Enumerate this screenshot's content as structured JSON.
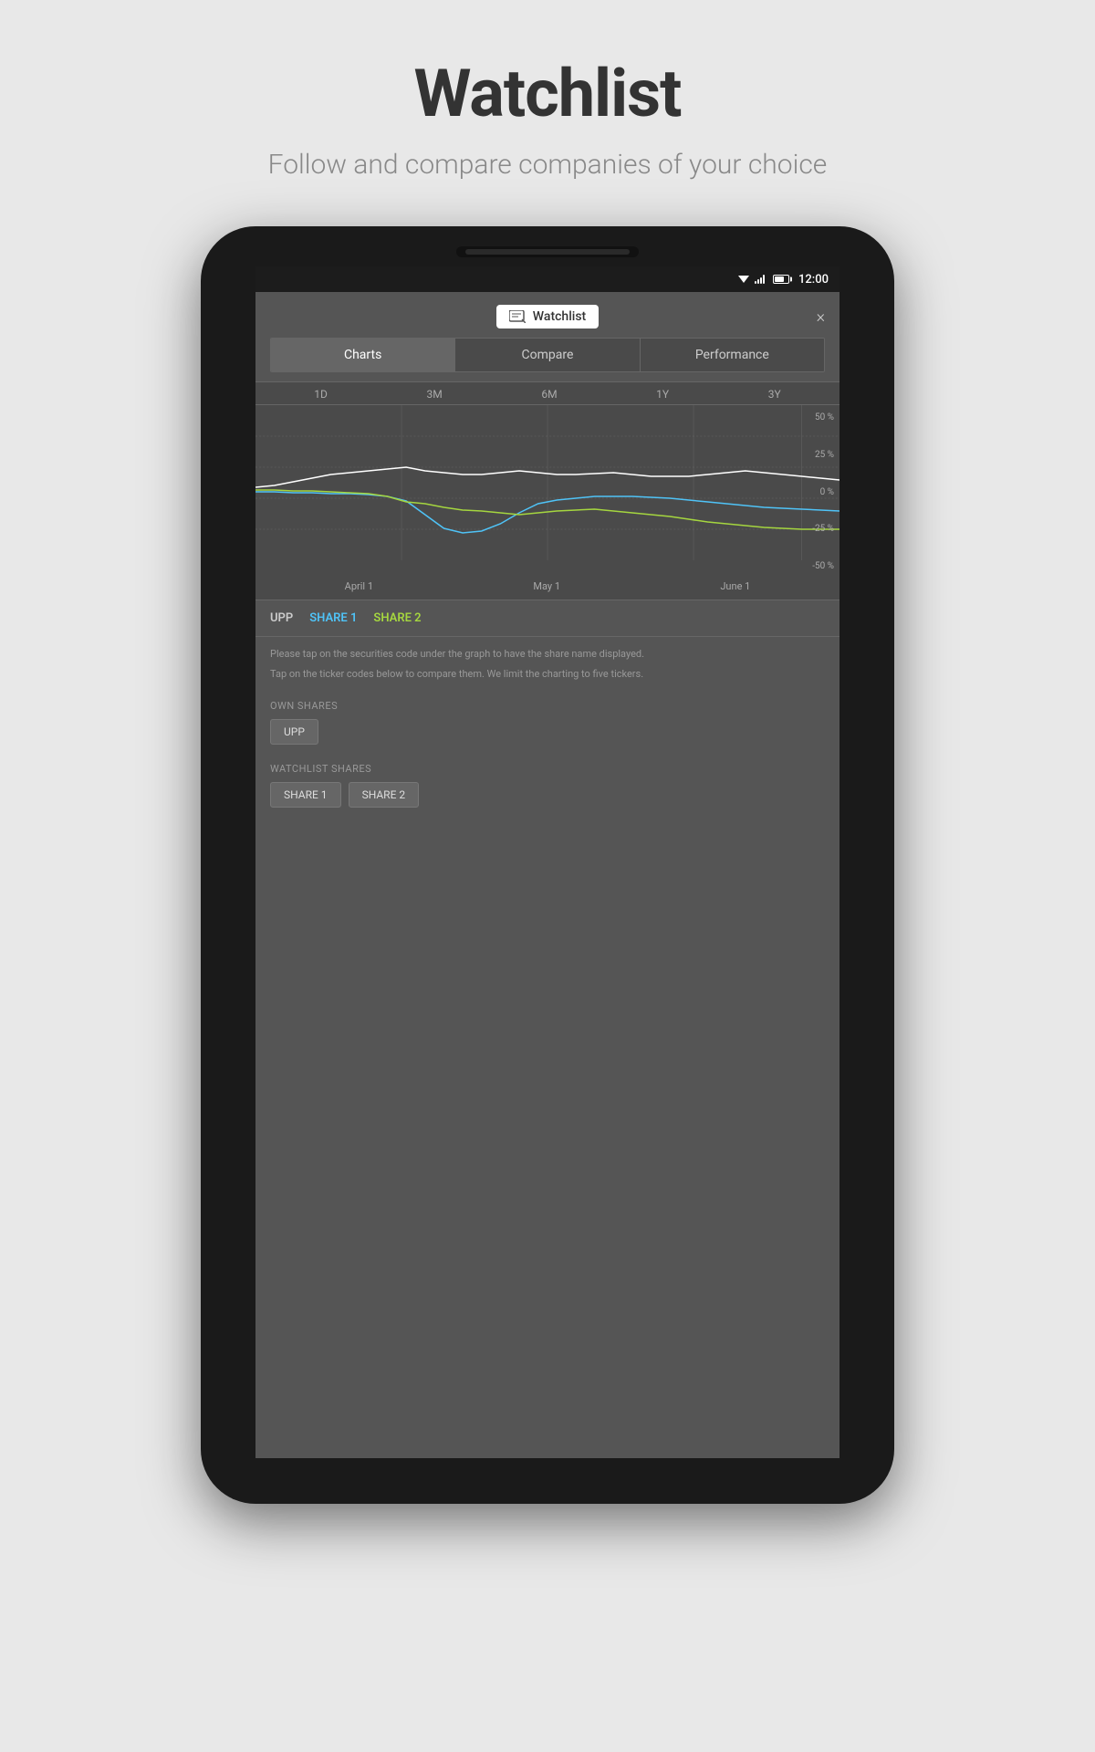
{
  "header": {
    "title": "Watchlist",
    "subtitle": "Follow and compare companies of your choice"
  },
  "statusBar": {
    "time": "12:00"
  },
  "app": {
    "title": "Watchlist",
    "closeBtn": "×",
    "tabs": [
      {
        "id": "charts",
        "label": "Charts",
        "active": true
      },
      {
        "id": "compare",
        "label": "Compare",
        "active": false
      },
      {
        "id": "performance",
        "label": "Performance",
        "active": false
      }
    ],
    "timeAxis": [
      "1D",
      "3M",
      "6M",
      "1Y",
      "3Y"
    ],
    "yAxis": [
      "50 %",
      "25 %",
      "0 %",
      "-25 %",
      "-50 %"
    ],
    "xAxis": [
      "April 1",
      "May 1",
      "June 1"
    ],
    "legend": [
      {
        "id": "upp",
        "label": "UPP",
        "color": "#cccccc"
      },
      {
        "id": "share1",
        "label": "SHARE 1",
        "color": "#4fc3f7"
      },
      {
        "id": "share2",
        "label": "SHARE 2",
        "color": "#a5d63f"
      }
    ],
    "infoText1": "Please tap on the securities code under the graph to have the share name displayed.",
    "infoText2": "Tap on the ticker codes below to compare them. We limit the charting to five tickers.",
    "ownSharesLabel": "OWN SHARES",
    "ownShares": [
      "UPP"
    ],
    "watchlistSharesLabel": "WATCHLIST SHARES",
    "watchlistShares": [
      "SHARE 1",
      "SHARE 2"
    ]
  }
}
